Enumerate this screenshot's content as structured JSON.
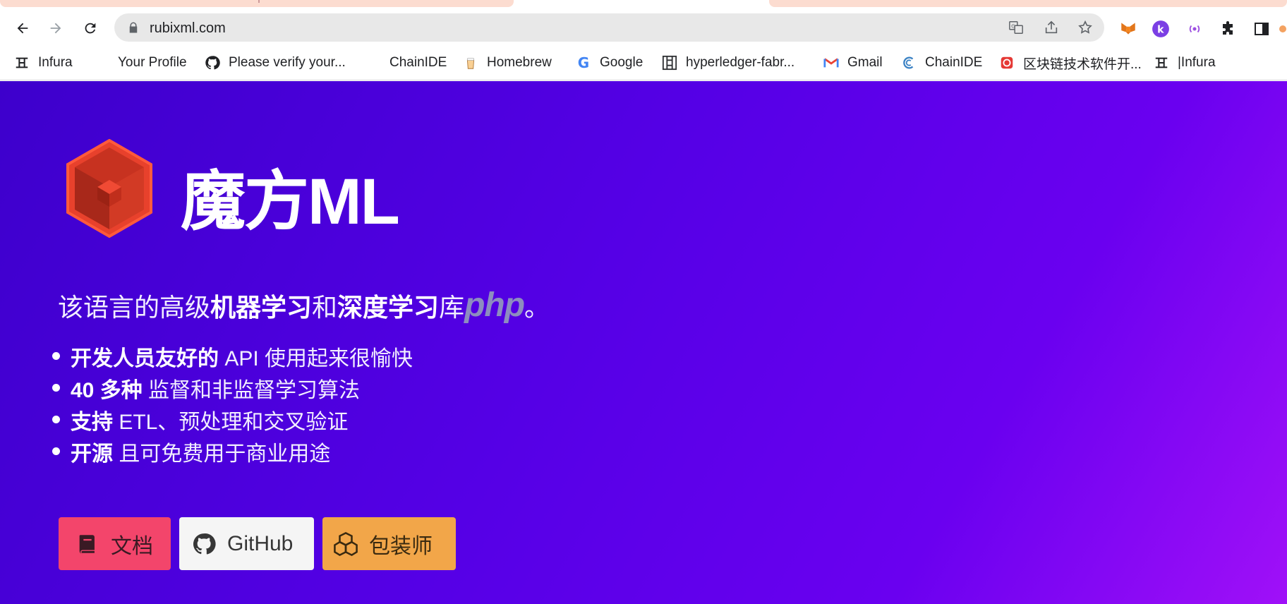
{
  "browser": {
    "url": "rubixml.com",
    "bookmarks": [
      {
        "label": "Infura",
        "icon": "infura-icon"
      },
      {
        "label": "Your Profile",
        "icon": "profile-icon"
      },
      {
        "label": "Please verify your...",
        "icon": "github-icon"
      },
      {
        "label": "ChainIDE",
        "icon": "chainide-icon"
      },
      {
        "label": "Homebrew",
        "icon": "homebrew-icon"
      },
      {
        "label": "Google",
        "icon": "google-icon"
      },
      {
        "label": "hyperledger-fabr...",
        "icon": "hyperledger-icon"
      },
      {
        "label": "Gmail",
        "icon": "gmail-icon"
      },
      {
        "label": "ChainIDE",
        "icon": "chainide-c-icon"
      },
      {
        "label": "区块链技术软件开...",
        "icon": "blockchain-icon"
      },
      {
        "label": "|Infura",
        "icon": "infura-icon"
      }
    ]
  },
  "hero": {
    "brand": "魔方ML",
    "tagline": {
      "part1": "该语言的高级",
      "bold1": "机器学习",
      "part2": "和",
      "bold2": "深度学习",
      "part3": "库",
      "php": "php",
      "end": "。"
    },
    "features": [
      {
        "bold": "开发人员友好的",
        "text": " API 使用起来很愉快"
      },
      {
        "bold": "40 多种",
        "text": " 监督和非监督学习算法"
      },
      {
        "bold": "支持",
        "text": " ETL、预处理和交叉验证"
      },
      {
        "bold": "开源",
        "text": " 且可免费用于商业用途"
      }
    ],
    "buttons": {
      "docs": "文档",
      "github": "GitHub",
      "packagist": "包装师"
    }
  },
  "colors": {
    "hero_gradient_start": "#3d00cc",
    "hero_gradient_end": "#a010f8",
    "docs_button": "#f3456b",
    "github_button": "#f5f5f5",
    "packagist_button": "#f2a649",
    "logo_red": "#e8412c"
  }
}
